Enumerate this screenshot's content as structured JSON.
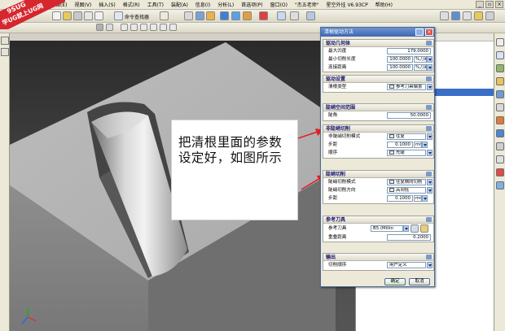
{
  "menubar": {
    "items": [
      "编辑(E)",
      "视图(V)",
      "插入(S)",
      "格式(R)",
      "工具(T)",
      "装配(A)",
      "信息(I)",
      "分析(L)",
      "首选项(P)",
      "窗口(O)",
      "\"杰五老师\"",
      "星空外挂 V6.93CP",
      "帮助(H)"
    ]
  },
  "toolbar": {
    "command_finder": "命令查找器"
  },
  "watermark": {
    "line1": "9SUG",
    "line2": "学UG就上UG网"
  },
  "annotation": {
    "line1": "把清根里面的参数",
    "line2": "设定好，如图所示"
  },
  "dialog": {
    "title": "清根驱动方法",
    "sec1": {
      "header": "驱动几何体",
      "max_concave_label": "最大凹度",
      "max_concave_value": "179.0000",
      "min_cut_length_label": "最小切削长度",
      "min_cut_length_value": "100.0000",
      "min_cut_length_unit": "%刀具",
      "merge_dist_label": "连接距离",
      "merge_dist_value": "100.0000",
      "merge_dist_unit": "%刀具"
    },
    "sec2": {
      "header": "驱动设置",
      "type_label": "清根类型",
      "type_value": "参考刀具偏置"
    },
    "sec3": {
      "header": "陡峭空间范围",
      "angle_label": "陡角",
      "angle_value": "50.0000"
    },
    "sec4": {
      "header": "非陡峭切削",
      "pattern_label": "非陡峭切削模式",
      "pattern_value": "往复",
      "step_label": "步距",
      "step_value": "0.1000",
      "step_unit": "mm",
      "order_label": "顺序",
      "order_value": "先陡"
    },
    "sec5": {
      "header": "陡峭切削",
      "pattern_label": "陡峭切削模式",
      "pattern_value": "往复横向切削",
      "dir_label": "陡峭切削方向",
      "dir_value": "高到低",
      "step_label": "步距",
      "step_value": "0.1000",
      "step_unit": "mm"
    },
    "sec6": {
      "header": "参考刀具",
      "tool_label": "参考刀具",
      "tool_value": "B5 (Millin",
      "overlap_label": "重叠距离",
      "overlap_value": "0.2000"
    },
    "sec7": {
      "header": "输出",
      "order_label": "切削顺序",
      "order_value": "用户定义"
    },
    "ok_label": "确定",
    "cancel_label": "取消"
  },
  "colors": {
    "dialog_title": "#3d67b2",
    "section_header_text": "#1a1a6e",
    "arrow": "#e0202a",
    "selection": "#3a6fc8"
  }
}
